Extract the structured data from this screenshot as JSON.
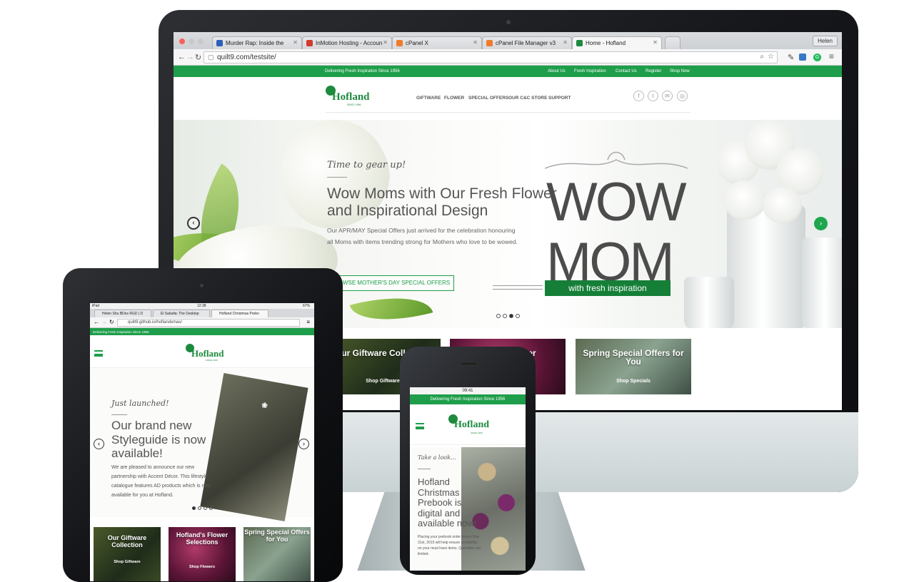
{
  "desktop": {
    "browser": {
      "tabs": [
        {
          "label": "Murder Rap: Inside the",
          "fav": "#2d5fb8"
        },
        {
          "label": "InMotion Hosting - Accoun",
          "fav": "#d13a2d"
        },
        {
          "label": "cPanel X",
          "fav": "#f07b2c"
        },
        {
          "label": "cPanel File Manager v3",
          "fav": "#f07b2c"
        },
        {
          "label": "Home - Hofland",
          "fav": "#1d8a3e"
        }
      ],
      "user_button": "Helen",
      "url": "quilt9.com/testsite/"
    },
    "site": {
      "tagline": "Delivering Fresh Inspiration Since 1956",
      "top_links": [
        "About Us",
        "Fresh Inspiration",
        "Contact Us",
        "Register",
        "Shop Now"
      ],
      "logo": "Hofland",
      "logo_sub": "SINCE 1956",
      "menu": [
        "GIFTWARE",
        "FLOWER",
        "SPECIAL OFFERS",
        "OUR C&C STORE",
        "SUPPORT"
      ],
      "social_icons": [
        "facebook-icon",
        "twitter-icon",
        "mail-icon",
        "instagram-icon"
      ],
      "hero": {
        "kicker": "Time to gear up!",
        "title": "Wow Moms with Our Fresh Flower and Inspirational Design",
        "body": "Our APR/MAY Special Offers just arrived for the celebration honouring all Moms with items trending strong for Mothers who love to be wowed.",
        "button": "OWSE MOTHER'S DAY SPECIAL OFFERS",
        "wow_line1": "WOW",
        "wow_line2": "MOM",
        "ribbon": "with fresh inspiration",
        "slides": 4,
        "active_slide": 3
      },
      "tiles": [
        {
          "title": "Our Giftware Collection",
          "sub": "Shop Giftware"
        },
        {
          "title": "wer",
          "sub": ""
        },
        {
          "title": "Spring Special Offers for You",
          "sub": "Shop Specials"
        }
      ]
    }
  },
  "tablet": {
    "status": {
      "device": "iPad",
      "time": "12:38",
      "battery": "67%"
    },
    "tabs": [
      "Helen Shu BDes RGD | D",
      "El Saladia: The Desktop",
      "Hofland Christmas Prebo"
    ],
    "url": "quilt9.github.io/hoflandxmas/",
    "tagline": "Delivering Fresh Inspiration Since 1956",
    "logo": "Hofland",
    "logo_sub": "SINCE 1956",
    "hero": {
      "kicker": "Just launched!",
      "title": "Our brand new Styleguide is now available!",
      "body": "We are pleased to announce our new partnership with Accent Décor. This lifestyle catalogue features AD products which is now available for you at Hofland."
    },
    "tiles": [
      {
        "title": "Our Giftware Collection",
        "sub": "Shop Giftware"
      },
      {
        "title": "Hofland's Flower Selections",
        "sub": "Shop Flowers"
      },
      {
        "title": "Spring Special Offers for You",
        "sub": ""
      }
    ]
  },
  "phone": {
    "status": {
      "time": "09:41"
    },
    "tagline": "Delivering Fresh Inspiration Since 1956",
    "logo": "Hofland",
    "logo_sub": "SINCE 1956",
    "hero": {
      "kicker": "Take a look...",
      "title": "Hofland Christmas Prebook is digital and available now!",
      "body": "Placing your prebook order before May 31st, 2015 will help ensure availability on your must have items. Quantities are limited."
    }
  },
  "colors": {
    "brand_green": "#1e9e4a",
    "dark_green": "#157f38",
    "text_gray": "#555555"
  }
}
